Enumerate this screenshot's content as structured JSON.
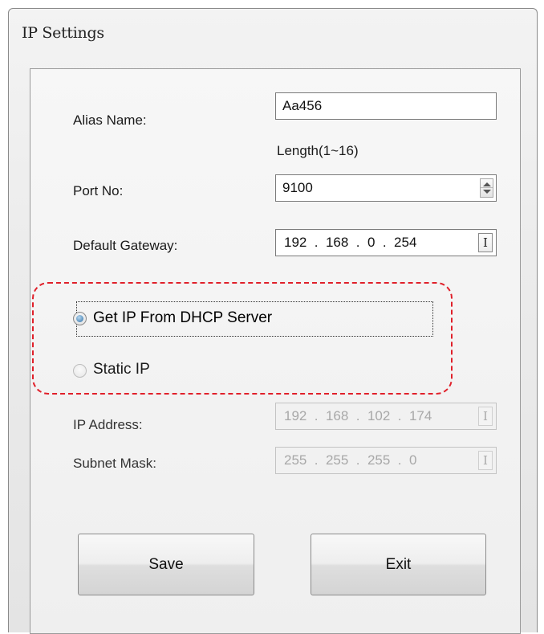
{
  "window": {
    "title": "IP Settings"
  },
  "form": {
    "alias_label": "Alias Name:",
    "alias_value": "Aa456",
    "alias_hint": "Length(1~16)",
    "port_label": "Port No:",
    "port_value": "9100",
    "gateway_label": "Default Gateway:",
    "gateway_value": "192  .  168  .  0  .  254",
    "dhcp_label": "Get IP From DHCP Server",
    "dhcp_selected": true,
    "static_label": "Static IP",
    "static_selected": false,
    "ip_label": "IP Address:",
    "ip_value": "192  .  168  .  102  .  174",
    "mask_label": "Subnet Mask:",
    "mask_value": "255  .  255  .  255  .  0"
  },
  "buttons": {
    "save_label": "Save",
    "exit_label": "Exit"
  },
  "colors": {
    "highlight_border": "#e0202a",
    "radio_selected": "#2d6fa6"
  },
  "icons": {
    "ip_field_control": "I-beam-icon"
  }
}
